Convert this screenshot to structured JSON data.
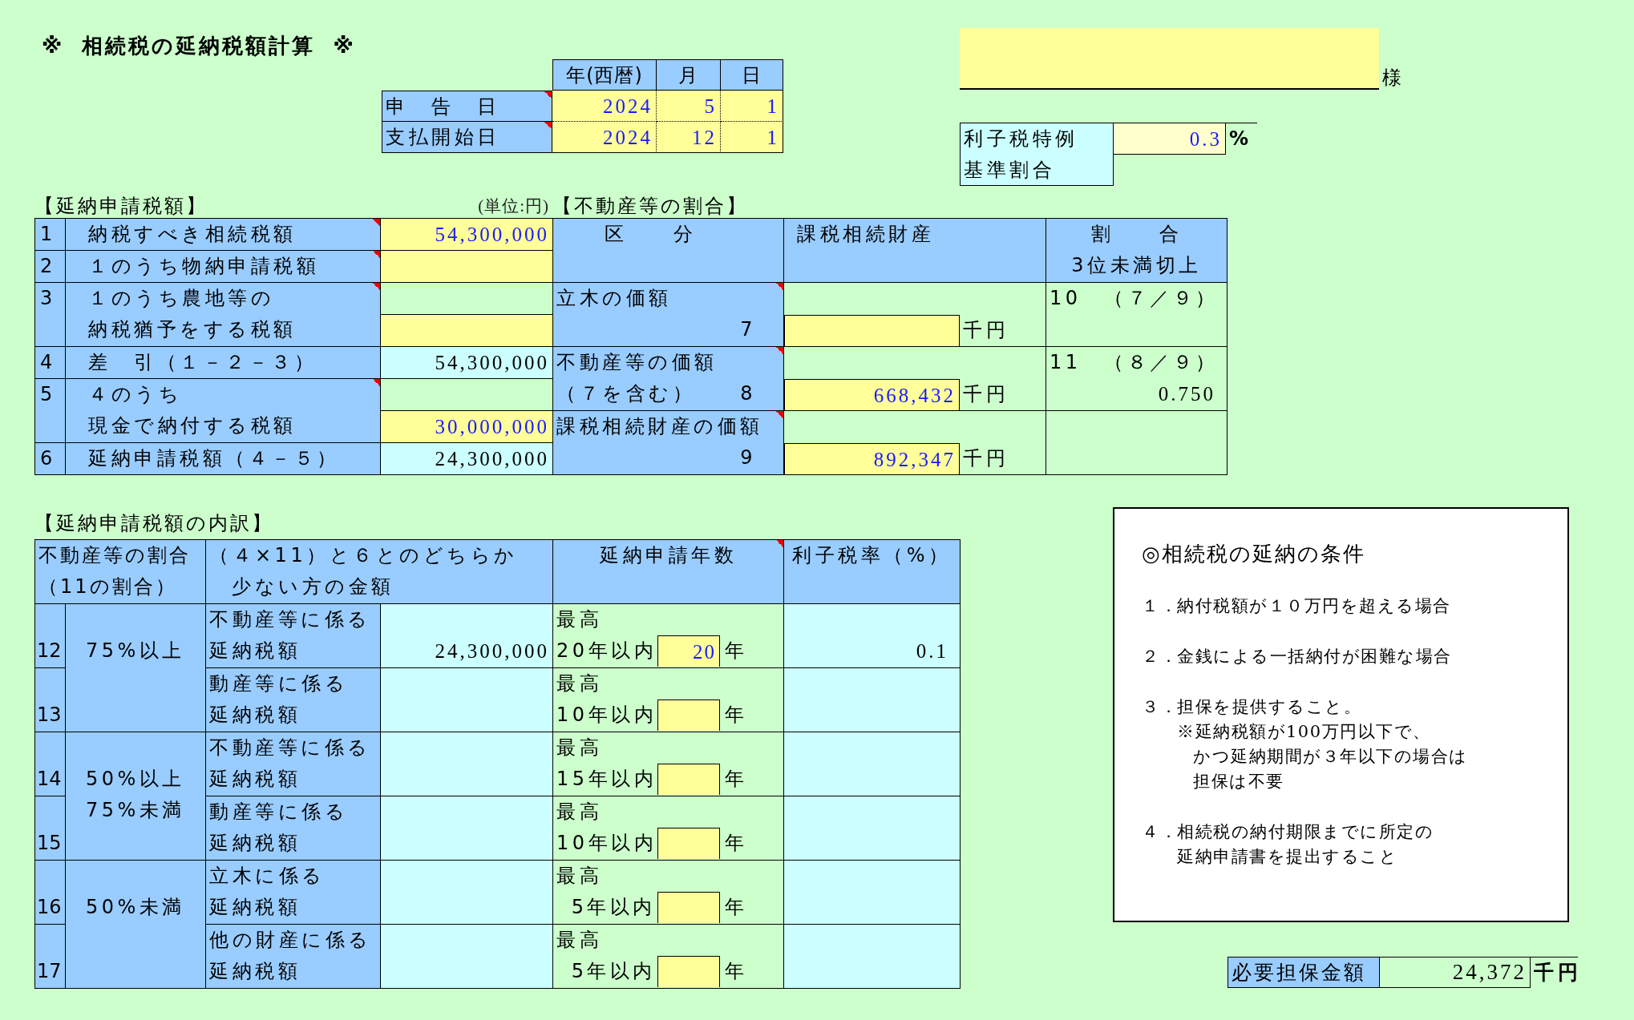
{
  "title": "※ 相続税の延納税額計算 ※",
  "dates": {
    "columns": [
      "年(西暦)",
      "月",
      "日"
    ],
    "rows": [
      {
        "label": "申　告　日",
        "comment": true,
        "values": [
          "2024",
          "5",
          "1"
        ]
      },
      {
        "label": "支払開始日",
        "comment": true,
        "values": [
          "2024",
          "12",
          "1"
        ]
      }
    ]
  },
  "recipient": {
    "honorific": "様"
  },
  "interest_rate_basis": {
    "label_lines": [
      "利子税特例",
      "基準割合"
    ],
    "value": "0.3",
    "unit": "%"
  },
  "deferral": {
    "heading": "【延納申請税額】",
    "unit_note": "(単位:円)",
    "rows": [
      {
        "no": "1",
        "label_lines": [
          "納税すべき相続税額"
        ],
        "comment": true,
        "cells": [
          {
            "kind": "input",
            "value": "54,300,000"
          }
        ]
      },
      {
        "no": "2",
        "label_lines": [
          "１のうち物納申請税額"
        ],
        "comment": true,
        "cells": [
          {
            "kind": "input"
          }
        ]
      },
      {
        "no": "3",
        "label_lines": [
          "１のうち農地等の",
          "納税猶予をする税額"
        ],
        "comment": true,
        "cells": [
          {
            "kind": "blank"
          },
          {
            "kind": "input"
          }
        ]
      },
      {
        "no": "4",
        "label_lines": [
          "差　引（１－２－３）"
        ],
        "comment": false,
        "cells": [
          {
            "kind": "computed",
            "value": "54,300,000"
          }
        ]
      },
      {
        "no": "5",
        "label_lines": [
          "４のうち",
          "現金で納付する税額"
        ],
        "comment": true,
        "cells": [
          {
            "kind": "blank"
          },
          {
            "kind": "input",
            "value": "30,000,000"
          }
        ]
      },
      {
        "no": "6",
        "label_lines": [
          "延納申請税額（４－５）"
        ],
        "comment": false,
        "cells": [
          {
            "kind": "computed",
            "value": "24,300,000"
          }
        ]
      }
    ]
  },
  "property_ratio": {
    "heading": "【不動産等の割合】",
    "headers": {
      "category": "区　　分",
      "assets": "課税相続財産",
      "ratio_lines": [
        "割　　合",
        "3位未満切上"
      ]
    },
    "rows": [
      {
        "label": "立木の価額",
        "no": "7",
        "comment": true,
        "unit": "千円",
        "ratio_label": "10　（７／９）"
      },
      {
        "label": "不動産等の価額",
        "sub_label": "（７を含む）",
        "no": "8",
        "comment": true,
        "value": "668,432",
        "unit": "千円",
        "ratio_label": "11　（８／９）",
        "ratio": "0.750"
      },
      {
        "label": "課税相続財産の価額",
        "no": "9",
        "comment": true,
        "value": "892,347",
        "unit": "千円"
      }
    ]
  },
  "breakdown": {
    "heading": "【延納申請税額の内訳】",
    "headers": {
      "share_lines": [
        "不動産等の割合",
        "（11の割合）"
      ],
      "amount_lines": [
        "（４×11）と６とのどちらか",
        "少ない方の金額"
      ],
      "years": "延納申請年数",
      "years_comment": true,
      "rate": "利子税率（%）"
    },
    "groups": [
      {
        "share_lines": [
          "75%以上"
        ],
        "rows": [
          {
            "no": "12",
            "label_lines": [
              "不動産等に係る",
              "延納税額"
            ],
            "amount": "24,300,000",
            "max_label": "最高",
            "limit": "20年以内",
            "years": "20",
            "years_unit": "年",
            "rate": "0.1"
          },
          {
            "no": "13",
            "label_lines": [
              "動産等に係る",
              "延納税額"
            ],
            "max_label": "最高",
            "limit": "10年以内",
            "years_unit": "年"
          }
        ]
      },
      {
        "share_lines": [
          "50%以上",
          "75%未満"
        ],
        "rows": [
          {
            "no": "14",
            "label_lines": [
              "不動産等に係る",
              "延納税額"
            ],
            "max_label": "最高",
            "limit": "15年以内",
            "years_unit": "年"
          },
          {
            "no": "15",
            "label_lines": [
              "動産等に係る",
              "延納税額"
            ],
            "max_label": "最高",
            "limit": "10年以内",
            "years_unit": "年"
          }
        ]
      },
      {
        "share_lines": [
          "50%未満"
        ],
        "rows": [
          {
            "no": "16",
            "label_lines": [
              "立木に係る",
              "延納税額"
            ],
            "max_label": "最高",
            "limit": "5年以内",
            "years_unit": "年"
          },
          {
            "no": "17",
            "label_lines": [
              "他の財産に係る",
              "延納税額"
            ],
            "max_label": "最高",
            "limit": "5年以内",
            "years_unit": "年"
          }
        ]
      }
    ]
  },
  "conditions": {
    "title": "◎相続税の延納の条件",
    "items": [
      {
        "no": "１．",
        "lines": [
          "納付税額が１０万円を超える場合"
        ]
      },
      {
        "no": "２．",
        "lines": [
          "金銭による一括納付が困難な場合"
        ]
      },
      {
        "no": "３．",
        "lines": [
          "担保を提供すること。"
        ],
        "note_lines": [
          "※延納税額が100万円以下で、",
          "かつ延納期間が３年以下の場合は",
          "担保は不要"
        ]
      },
      {
        "no": "４．",
        "lines": [
          "相続税の納付期限までに所定の",
          "延納申請書を提出すること"
        ]
      }
    ]
  },
  "collateral": {
    "label": "必要担保金額",
    "value": "24,372",
    "unit": "千円"
  }
}
